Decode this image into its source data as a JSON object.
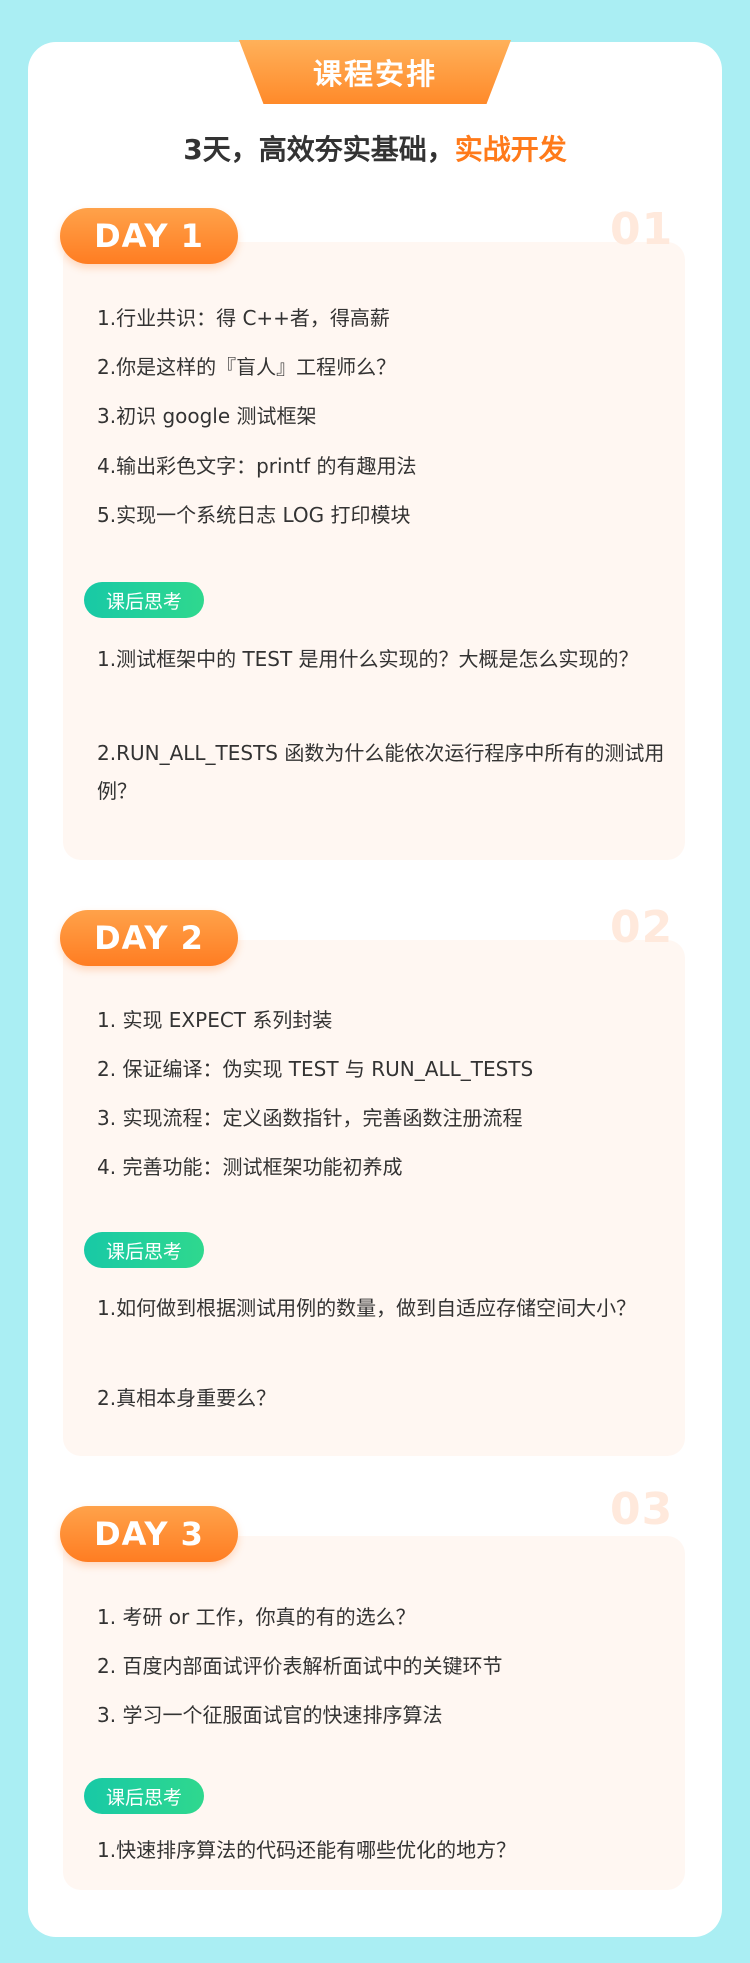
{
  "header": {
    "title": "课程安排",
    "subtitle_main": "3天，高效夯实基础，",
    "subtitle_highlight": "实战开发"
  },
  "think_label": "课后思考",
  "days": [
    {
      "badge": "DAY 1",
      "num": "01",
      "items": [
        "1.行业共识：得 C++者，得高薪",
        "2.你是这样的『盲人』工程师么？",
        "3.初识 google 测试框架",
        "4.输出彩色文字：printf 的有趣用法",
        "5.实现一个系统日志 LOG 打印模块"
      ],
      "questions": [
        "1.测试框架中的 TEST 是用什么实现的？大概是怎么实现的？",
        "2.RUN_ALL_TESTS 函数为什么能依次运行程序中所有的测试用例？"
      ]
    },
    {
      "badge": "DAY 2",
      "num": "02",
      "items": [
        "1. 实现 EXPECT 系列封装",
        "2. 保证编译：伪实现 TEST 与 RUN_ALL_TESTS",
        "3. 实现流程：定义函数指针，完善函数注册流程",
        "4. 完善功能：测试框架功能初养成"
      ],
      "questions": [
        "1.如何做到根据测试用例的数量，做到自适应存储空间大小？",
        "2.真相本身重要么？"
      ]
    },
    {
      "badge": "DAY 3",
      "num": "03",
      "items": [
        "1. 考研 or 工作，你真的有的选么？",
        "2. 百度内部面试评价表解析面试中的关键环节",
        "3. 学习一个征服面试官的快速排序算法"
      ],
      "questions": [
        "1.快速排序算法的代码还能有哪些优化的地方？"
      ]
    }
  ]
}
